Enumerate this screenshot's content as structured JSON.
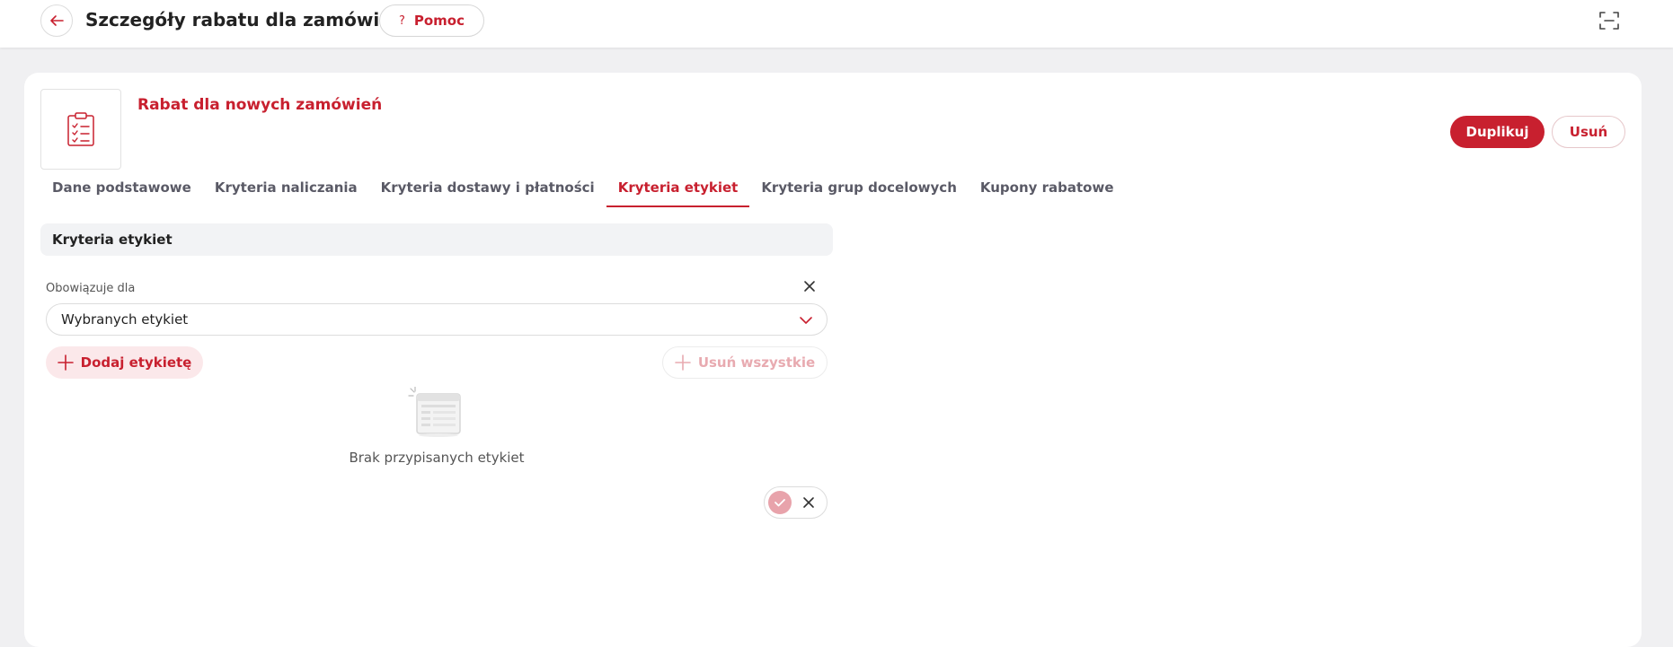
{
  "header": {
    "title": "Szczegóły rabatu dla zamówień",
    "help_label": "Pomoc",
    "help_glyph": "?"
  },
  "discount": {
    "name": "Rabat dla nowych zamówień",
    "duplicate_label": "Duplikuj",
    "delete_label": "Usuń"
  },
  "tabs": [
    {
      "label": "Dane podstawowe",
      "active": false
    },
    {
      "label": "Kryteria naliczania",
      "active": false
    },
    {
      "label": "Kryteria dostawy i płatności",
      "active": false
    },
    {
      "label": "Kryteria etykiet",
      "active": true
    },
    {
      "label": "Kryteria grup docelowych",
      "active": false
    },
    {
      "label": "Kupony rabatowe",
      "active": false
    }
  ],
  "section": {
    "title": "Kryteria etykiet",
    "field_label": "Obowiązuje dla",
    "field_value": "Wybranych etykiet",
    "add_label": "Dodaj etykietę",
    "remove_all_label": "Usuń wszystkie",
    "empty_text": "Brak przypisanych etykiet"
  },
  "colors": {
    "accent": "#c8202f",
    "accent_soft": "#fbe8ea",
    "background": "#f0f0f2"
  }
}
